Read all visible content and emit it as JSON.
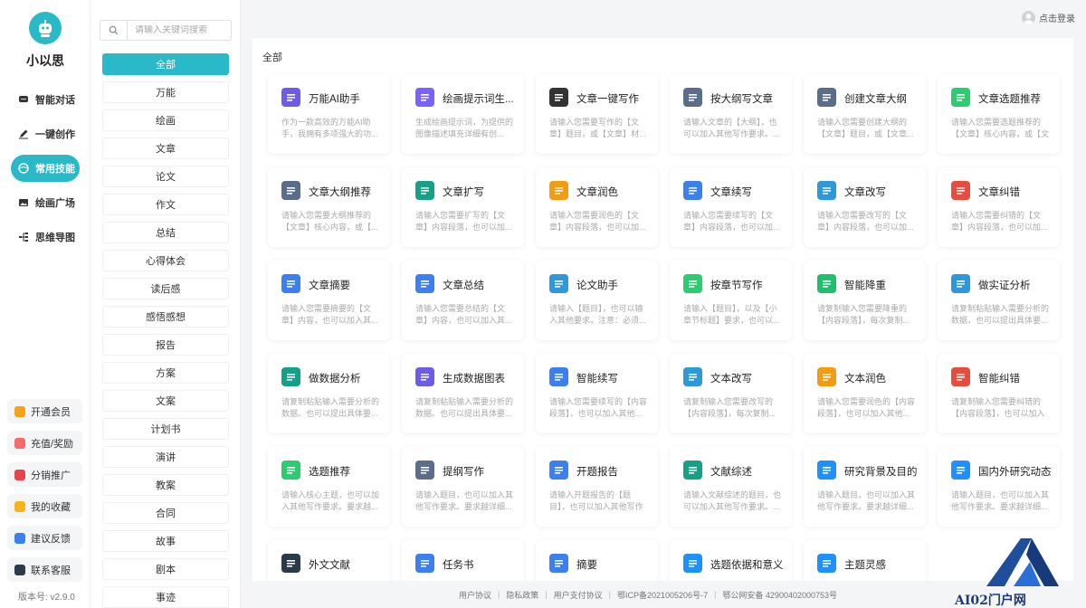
{
  "app": {
    "name": "小以思",
    "version": "版本号: v2.9.0"
  },
  "nav": {
    "items": [
      {
        "label": "智能对话",
        "icon": "chat-icon",
        "active": false
      },
      {
        "label": "一键创作",
        "icon": "pen-icon",
        "active": false
      },
      {
        "label": "常用技能",
        "icon": "skills-icon",
        "active": true
      },
      {
        "label": "绘画广场",
        "icon": "image-icon",
        "active": false
      },
      {
        "label": "思维导图",
        "icon": "mindmap-icon",
        "active": false
      }
    ],
    "bottom": [
      {
        "label": "开通会员",
        "icon": "vip-icon",
        "color": "#f7a21b"
      },
      {
        "label": "充值/奖励",
        "icon": "recharge-icon",
        "color": "#f56c6c"
      },
      {
        "label": "分销推广",
        "icon": "share-icon",
        "color": "#e6464b"
      },
      {
        "label": "我的收藏",
        "icon": "star-icon",
        "color": "#f7b51b"
      },
      {
        "label": "建议反馈",
        "icon": "feedback-icon",
        "color": "#3c7ff0"
      },
      {
        "label": "联系客服",
        "icon": "service-icon",
        "color": "#2b3a4a"
      }
    ]
  },
  "search": {
    "placeholder": "请输入关键词搜索"
  },
  "categories": [
    "全部",
    "万能",
    "绘画",
    "文章",
    "论文",
    "作文",
    "总结",
    "心得体会",
    "读后感",
    "感悟感想",
    "报告",
    "方案",
    "文案",
    "计划书",
    "演讲",
    "教案",
    "合同",
    "故事",
    "剧本",
    "事迹"
  ],
  "topbar": {
    "login": "点击登录"
  },
  "main": {
    "title": "全部",
    "cards": [
      {
        "title": "万能AI助手",
        "desc": "作为一款高效的万能AI助手，我拥有多项强大的功...",
        "icon": "monitor-icon",
        "color": "#6c5ce7"
      },
      {
        "title": "绘画提示词生...",
        "desc": "生成绘画提示词，为提供的图像描述填充详细有创...",
        "icon": "paint-icon",
        "color": "#7b61ff"
      },
      {
        "title": "文章一键写作",
        "desc": "请输入您需要写作的【文章】题目，或【文章】材...",
        "icon": "pencil-icon",
        "color": "#333333"
      },
      {
        "title": "按大纲写文章",
        "desc": "请输入文章的【大纲】，也可以加入其他写作要求。...",
        "icon": "outline-icon",
        "color": "#5a6d8c"
      },
      {
        "title": "创建文章大纲",
        "desc": "请输入您需要创建大纲的【文章】题目，或【文章...",
        "icon": "outline-icon",
        "color": "#5a6d8c"
      },
      {
        "title": "文章选题推荐",
        "desc": "请输入您需要选题推荐的【文章】核心内容，或【文章...",
        "icon": "topic-icon",
        "color": "#2ecc71"
      },
      {
        "title": "文章大纲推荐",
        "desc": "请输入您需要大纲推荐的【文章】核心内容，或【...",
        "icon": "outline-icon",
        "color": "#5a6d8c"
      },
      {
        "title": "文章扩写",
        "desc": "请输入您需要扩写的【文章】内容段落，也可以加...",
        "icon": "expand-icon",
        "color": "#16a085"
      },
      {
        "title": "文章润色",
        "desc": "请输入您需要润色的【文章】内容段落，也可以加...",
        "icon": "polish-icon",
        "color": "#f39c12"
      },
      {
        "title": "文章续写",
        "desc": "请输入您需要续写的【文章】内容段落，也可以加...",
        "icon": "continue-icon",
        "color": "#3c7ff0"
      },
      {
        "title": "文章改写",
        "desc": "请输入您需要改写的【文章】内容段落，也可以加...",
        "icon": "rewrite-icon",
        "color": "#2d98da"
      },
      {
        "title": "文章纠错",
        "desc": "请输入您需要纠错的【文章】内容段落，也可以加...",
        "icon": "eraser-icon",
        "color": "#e74c3c"
      },
      {
        "title": "文章摘要",
        "desc": "请输入您需要摘要的【文章】内容，也可以加入其...",
        "icon": "summary-icon",
        "color": "#3c7ff0"
      },
      {
        "title": "文章总结",
        "desc": "请输入您需要总结的【文章】内容，也可以加入其...",
        "icon": "conclusion-icon",
        "color": "#3c7ff0"
      },
      {
        "title": "论文助手",
        "desc": "请输入【题目】，也可以输入其他要求。注意：必须...",
        "icon": "thesis-icon",
        "color": "#2d98da"
      },
      {
        "title": "按章节写作",
        "desc": "请输入【题目】，以及【小章节标题】要求，也可以...",
        "icon": "chapter-icon",
        "color": "#2ecc71"
      },
      {
        "title": "智能降重",
        "desc": "请复制输入您需要降重的【内容段落】，每次复制...",
        "icon": "reduce-icon",
        "color": "#20bf6b"
      },
      {
        "title": "做实证分析",
        "desc": "请复制粘贴输入需要分析的数据，也可以提出具体要...",
        "icon": "vs-icon",
        "color": "#2d98da"
      },
      {
        "title": "做数据分析",
        "desc": "请复制粘贴输入需要分析的数据。也可以提出具体要...",
        "icon": "data-icon",
        "color": "#16a085"
      },
      {
        "title": "生成数据图表",
        "desc": "请复制粘贴输入需要分析的数据。也可以提出具体要...",
        "icon": "pie-icon",
        "color": "#6c5ce7"
      },
      {
        "title": "智能续写",
        "desc": "请输入您需要续写的【内容段落】，也可以加入其他...",
        "icon": "continue-icon",
        "color": "#3c7ff0"
      },
      {
        "title": "文本改写",
        "desc": "请复制输入您需要改写的【内容段落】，每次复制...",
        "icon": "rewrite-icon",
        "color": "#2d98da"
      },
      {
        "title": "文本润色",
        "desc": "请输入您需要润色的【内容段落】，也可以加入其他...",
        "icon": "polish-icon",
        "color": "#f39c12"
      },
      {
        "title": "智能纠错",
        "desc": "请复制输入您需要纠错的【内容段落】，也可以加入其他...",
        "icon": "eraser-icon",
        "color": "#e74c3c"
      },
      {
        "title": "选题推荐",
        "desc": "请输入核心主题，也可以加入其他写作要求。要求越...",
        "icon": "clipboard-icon",
        "color": "#2ecc71"
      },
      {
        "title": "提纲写作",
        "desc": "请输入题目，也可以加入其他写作要求。要求越详细...",
        "icon": "outline-icon",
        "color": "#5a6d8c"
      },
      {
        "title": "开题报告",
        "desc": "请输入开题报告的【题目】，也可以加入其他写作要...",
        "icon": "report-icon",
        "color": "#3c7ff0"
      },
      {
        "title": "文献综述",
        "desc": "请输入文献综述的题目，也可以加入其他写作要求。...",
        "icon": "literature-icon",
        "color": "#16a085"
      },
      {
        "title": "研究背景及目的",
        "desc": "请输入题目，也可以加入其他写作要求。要求越详细...",
        "icon": "research-icon",
        "color": "#1e90ff"
      },
      {
        "title": "国内外研究动态",
        "desc": "请输入题目，也可以加入其他写作要求。要求越详细...",
        "icon": "research-icon",
        "color": "#1e90ff"
      },
      {
        "title": "外文文献",
        "desc": "",
        "icon": "foreign-icon",
        "color": "#2b3a4a"
      },
      {
        "title": "任务书",
        "desc": "",
        "icon": "task-icon",
        "color": "#3c7ff0"
      },
      {
        "title": "摘要",
        "desc": "",
        "icon": "abstract-icon",
        "color": "#3c7ff0"
      },
      {
        "title": "选题依据和意义",
        "desc": "",
        "icon": "basis-icon",
        "color": "#1e90ff"
      },
      {
        "title": "主题灵感",
        "desc": "",
        "icon": "idea-icon",
        "color": "#1e90ff"
      }
    ]
  },
  "footer": {
    "links": [
      "用户协议",
      "隐私政策",
      "用户支付协议",
      "鄂ICP备2021005206号-7",
      "鄂公网安备 42900402000753号"
    ]
  },
  "watermark": {
    "text": "AI02门户网"
  },
  "colors": {
    "accent": "#2ab9c8"
  }
}
